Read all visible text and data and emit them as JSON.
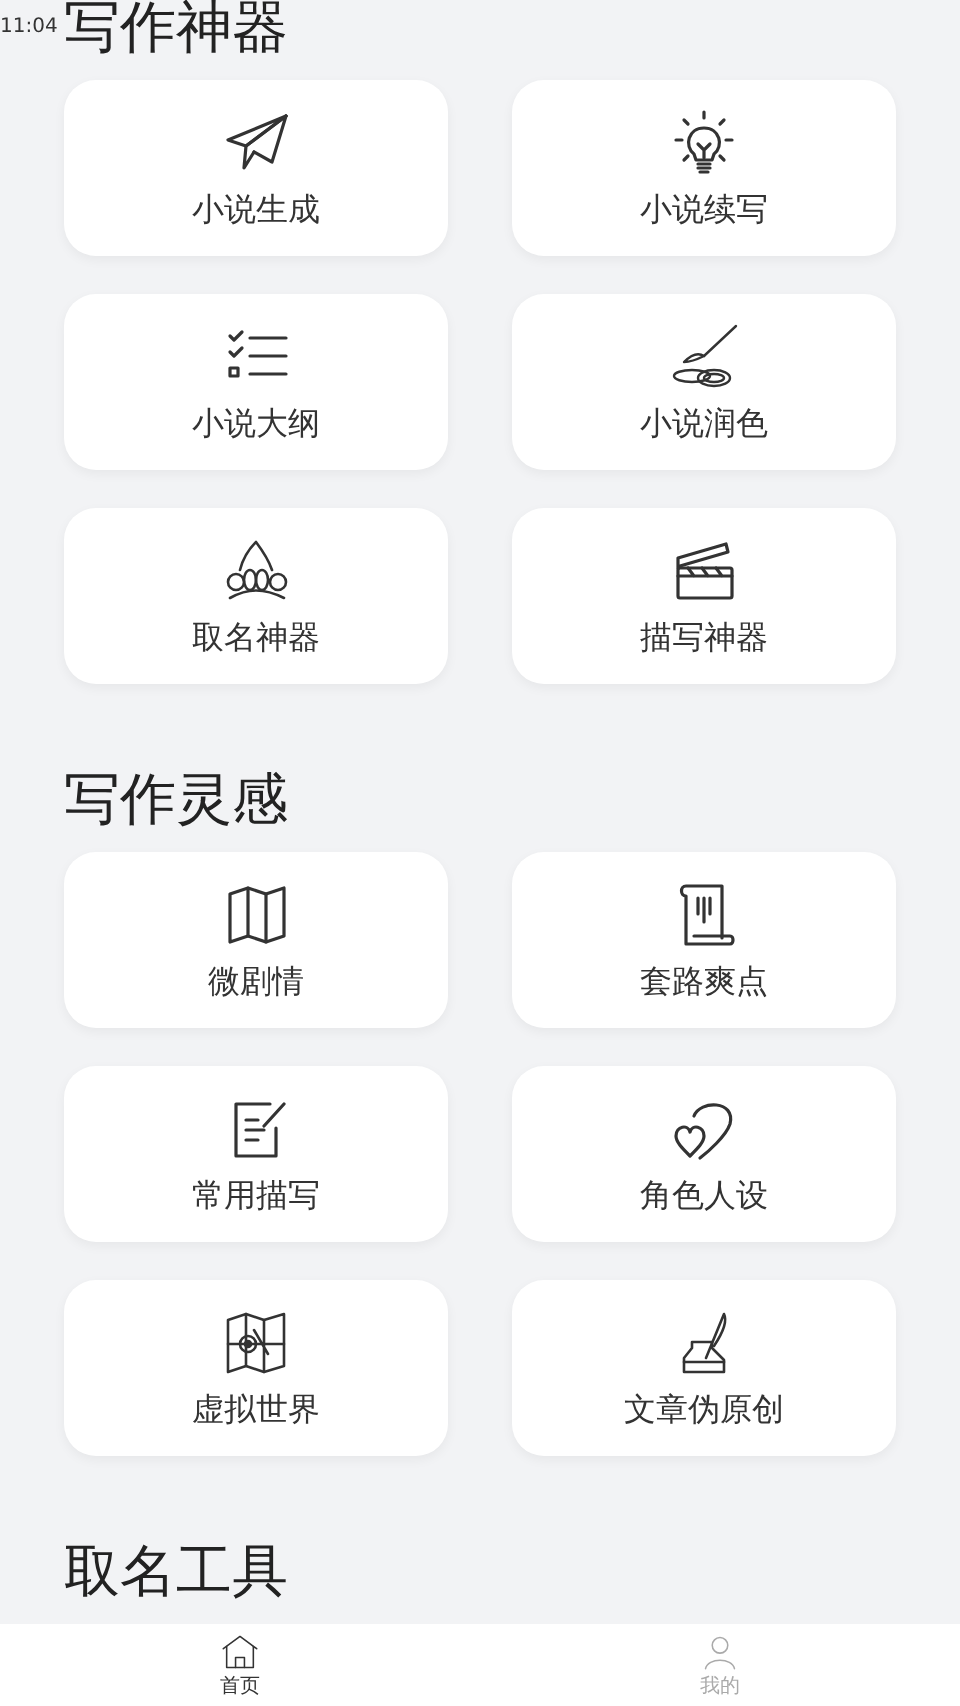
{
  "status_bar": {
    "time": "11:04"
  },
  "sections": [
    {
      "title": "写作神器",
      "items": [
        {
          "label": "小说生成"
        },
        {
          "label": "小说续写"
        },
        {
          "label": "小说大纲"
        },
        {
          "label": "小说润色"
        },
        {
          "label": "取名神器"
        },
        {
          "label": "描写神器"
        }
      ]
    },
    {
      "title": "写作灵感",
      "items": [
        {
          "label": "微剧情"
        },
        {
          "label": "套路爽点"
        },
        {
          "label": "常用描写"
        },
        {
          "label": "角色人设"
        },
        {
          "label": "虚拟世界"
        },
        {
          "label": "文章伪原创"
        }
      ]
    },
    {
      "title": "取名工具"
    }
  ],
  "bottom_nav": [
    {
      "label": "首页",
      "selected": true
    },
    {
      "label": "我的",
      "selected": false
    }
  ]
}
